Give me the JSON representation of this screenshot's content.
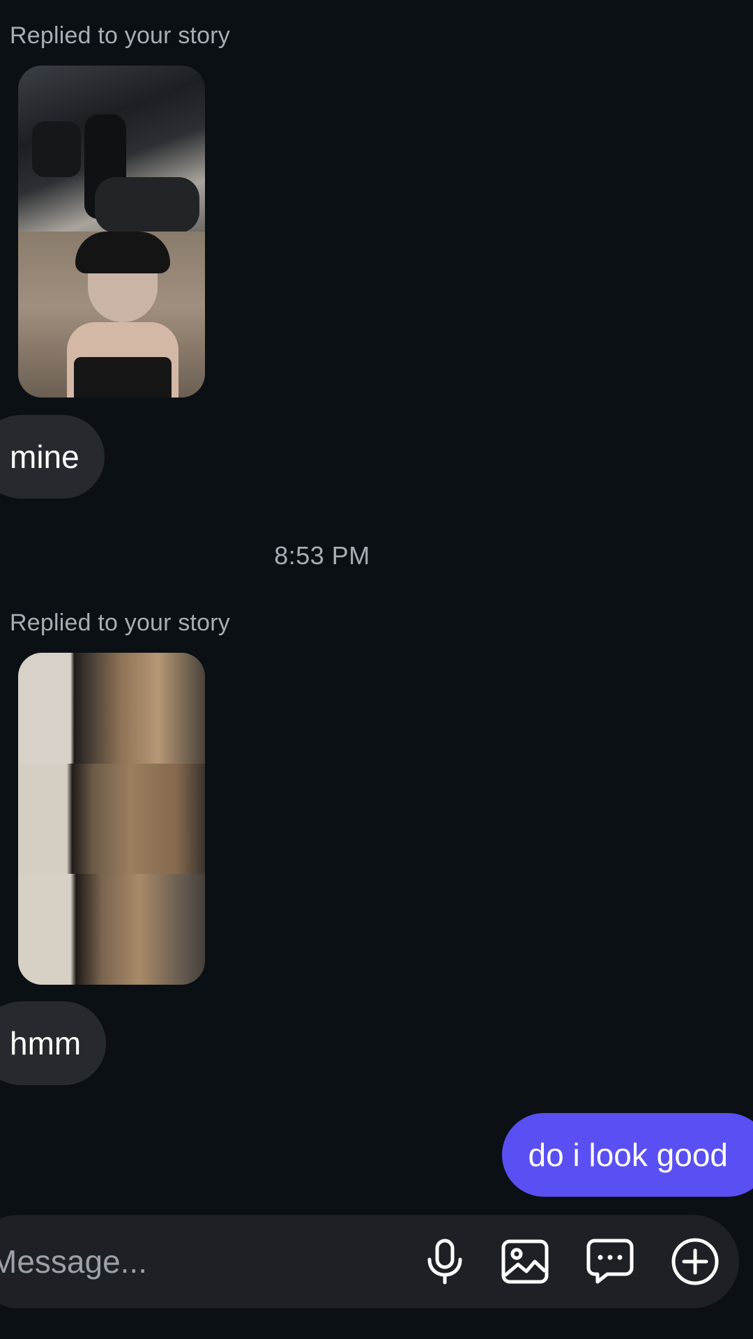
{
  "messages": {
    "story_reply_1": {
      "label": "Replied to your story",
      "media_panels": [
        "car-interior-photo",
        "selfie-photo"
      ]
    },
    "incoming_1": {
      "text": "mine"
    },
    "timestamp": "8:53 PM",
    "story_reply_2": {
      "label": "Replied to your story",
      "media_panels": [
        "mirror-photo-1",
        "mirror-photo-2",
        "mirror-photo-3"
      ]
    },
    "incoming_2": {
      "text": "hmm"
    },
    "outgoing_1": {
      "text": "do i look good"
    }
  },
  "composer": {
    "placeholder": "Message...",
    "icons": [
      "microphone-icon",
      "image-icon",
      "chat-sticker-icon",
      "plus-circle-icon"
    ]
  },
  "colors": {
    "background": "#0b1014",
    "incoming_bubble": "#262a2f",
    "outgoing_bubble": "#5a4ff2",
    "secondary_text": "#a8aeb5",
    "composer_bg": "#1d2125"
  }
}
